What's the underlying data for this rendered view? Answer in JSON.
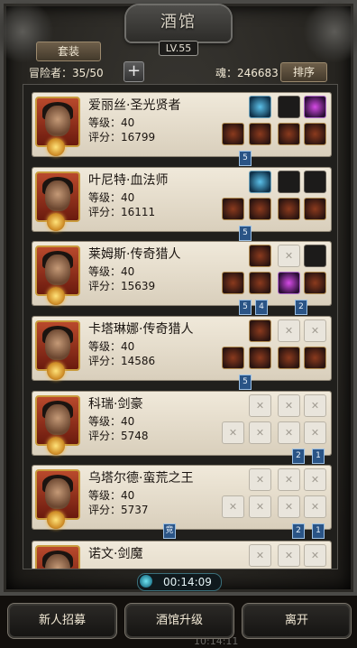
{
  "header": {
    "title": "酒馆",
    "level": "LV.55",
    "set_button": "套装",
    "adventurer_count": "冒险者：35/50",
    "plus_label": "+",
    "soul": "魂：246683",
    "sort_button": "排序"
  },
  "heroes": [
    {
      "name": "爱丽丝·圣光贤者",
      "level": "等级：40",
      "score": "评分：16799"
    },
    {
      "name": "叶尼特·血法师",
      "level": "等级：40",
      "score": "评分：16111"
    },
    {
      "name": "莱姆斯·传奇猎人",
      "level": "等级：40",
      "score": "评分：15639"
    },
    {
      "name": "卡塔琳娜·传奇猎人",
      "level": "等级：40",
      "score": "评分：14586"
    },
    {
      "name": "科瑞·剑豪",
      "level": "等级：40",
      "score": "评分：5748"
    },
    {
      "name": "乌塔尔德·蛮荒之王",
      "level": "等级：40",
      "score": "评分：5737"
    },
    {
      "name": "诺文·剑魔",
      "level": "",
      "score": ""
    }
  ],
  "tags": {
    "t1": "5",
    "t2": "5",
    "t3a": "5",
    "t3b": "4",
    "t3c": "2",
    "t4": "5",
    "t5a": "2",
    "t5b": "1",
    "t6a": "竞",
    "t6b": "2",
    "t6c": "1"
  },
  "timer": "00:14:09",
  "buttons": {
    "recruit": "新人招募",
    "upgrade": "酒馆升级",
    "leave": "离开"
  },
  "background_clock": "10:14:11"
}
